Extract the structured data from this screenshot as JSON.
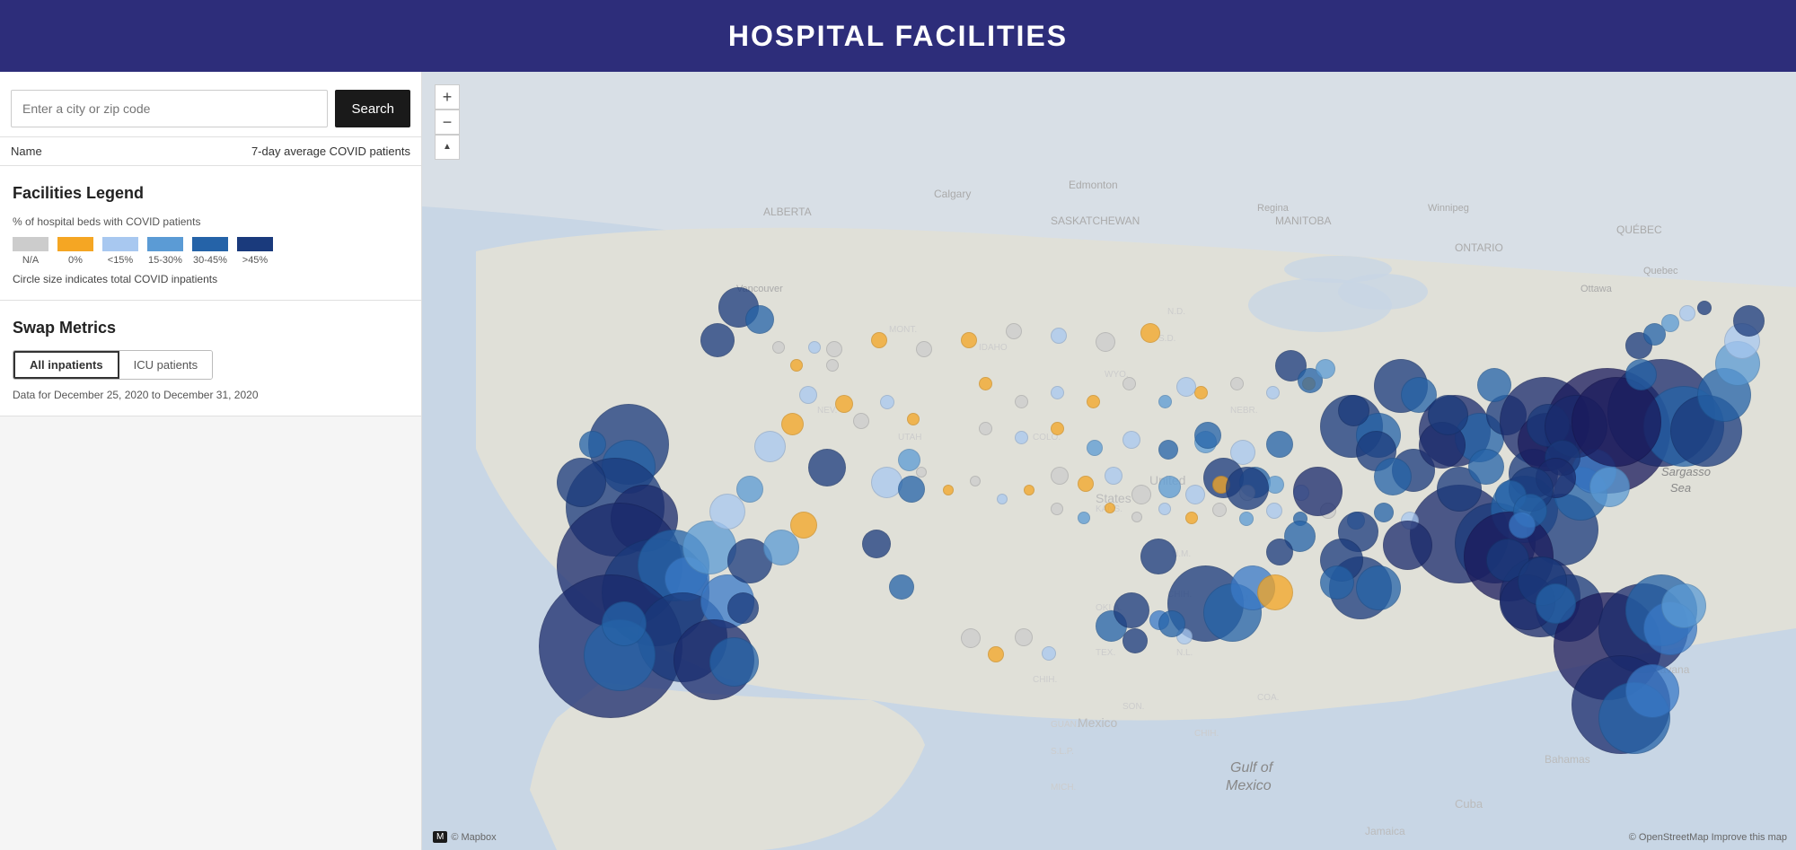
{
  "header": {
    "title": "HOSPITAL FACILITIES"
  },
  "search": {
    "placeholder": "Enter a city or zip code",
    "button_label": "Search"
  },
  "table_header": {
    "name_col": "Name",
    "value_col": "7-day average COVID patients"
  },
  "legend": {
    "title": "Facilities Legend",
    "subtitle": "% of hospital beds with COVID patients",
    "swatches": [
      {
        "color": "#cccccc",
        "label": "N/A"
      },
      {
        "color": "#f5a623",
        "label": "0%"
      },
      {
        "color": "#a8c8f0",
        "label": "<15%"
      },
      {
        "color": "#5b9bd5",
        "label": "15-30%"
      },
      {
        "color": "#2563a8",
        "label": "30-45%"
      },
      {
        "color": "#1a3a7c",
        "label": ">45%"
      }
    ],
    "note": "Circle size indicates total COVID inpatients"
  },
  "swap_metrics": {
    "title": "Swap Metrics",
    "options": [
      {
        "label": "All inpatients",
        "active": true
      },
      {
        "label": "ICU patients",
        "active": false
      }
    ],
    "date_range": "Data for December 25, 2020 to December 31, 2020"
  },
  "map": {
    "zoom_in_label": "+",
    "zoom_out_label": "−",
    "reset_label": "▲",
    "mapbox_label": "© Mapbox",
    "attribution": "© OpenStreetMap  Improve this map"
  },
  "icons": {
    "mapbox_icon": "⬤"
  }
}
